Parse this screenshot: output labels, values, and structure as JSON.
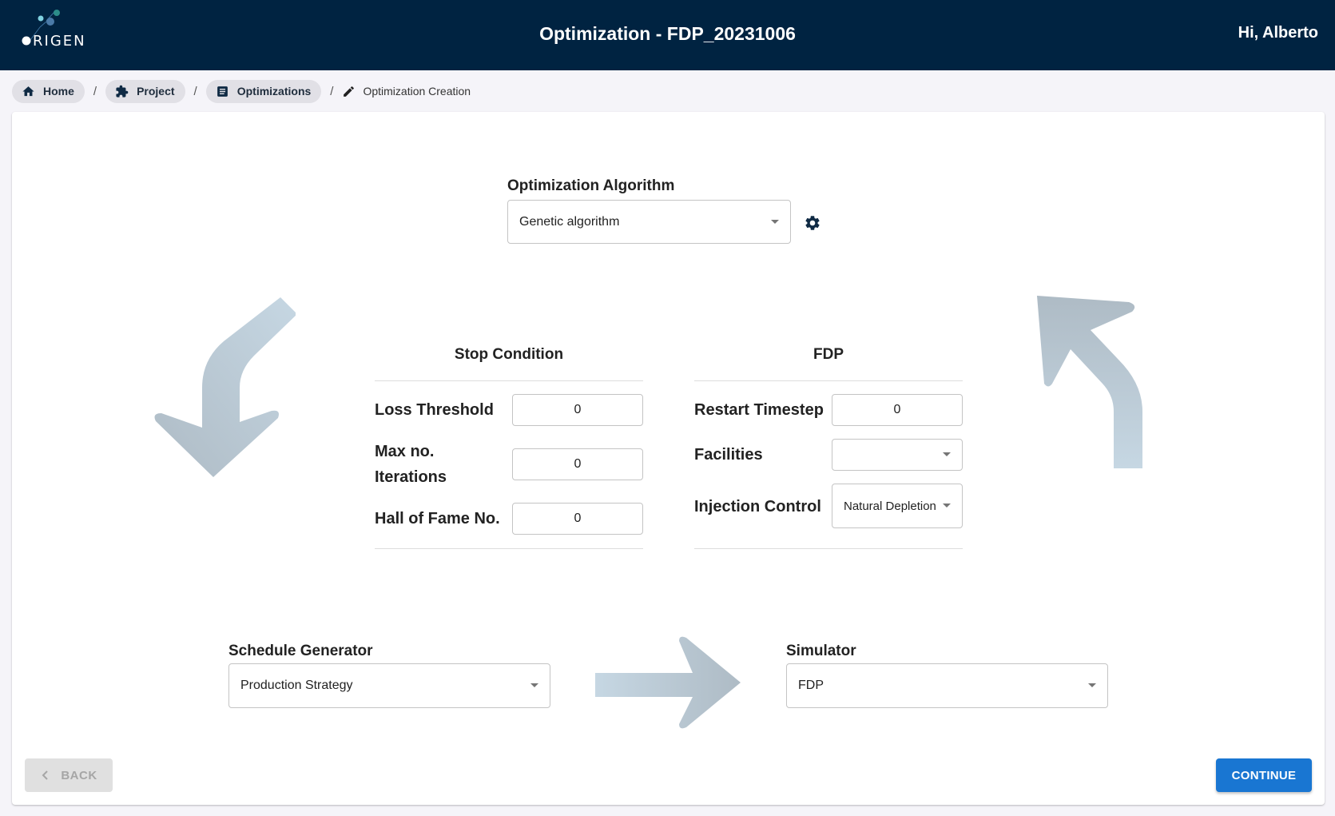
{
  "header": {
    "logo_text": "ORIGEN",
    "title": "Optimization - FDP_20231006",
    "greeting": "Hi, Alberto"
  },
  "breadcrumb": {
    "items": [
      {
        "label": "Home",
        "icon": "home-icon"
      },
      {
        "label": "Project",
        "icon": "puzzle-icon"
      },
      {
        "label": "Optimizations",
        "icon": "document-icon"
      }
    ],
    "separator": "/",
    "current": {
      "label": "Optimization Creation",
      "icon": "pencil-icon"
    }
  },
  "algorithm": {
    "label": "Optimization Algorithm",
    "value": "Genetic algorithm",
    "settings_icon": "gear-icon"
  },
  "stop_condition": {
    "title": "Stop Condition",
    "fields": [
      {
        "label": "Loss Threshold",
        "value": "0"
      },
      {
        "label_line1": "Max no.",
        "label_line2": "Iterations",
        "value": "0"
      },
      {
        "label": "Hall of Fame No.",
        "value": "0"
      }
    ]
  },
  "fdp": {
    "title": "FDP",
    "restart_timestep": {
      "label": "Restart Timestep",
      "value": "0"
    },
    "facilities": {
      "label": "Facilities",
      "value": ""
    },
    "injection_control": {
      "label": "Injection Control",
      "value": "Natural Depletion"
    }
  },
  "schedule_generator": {
    "label": "Schedule Generator",
    "value": "Production Strategy"
  },
  "simulator": {
    "label": "Simulator",
    "value": "FDP"
  },
  "actions": {
    "back_label": "BACK",
    "continue_label": "CONTINUE"
  },
  "colors": {
    "header_bg": "#002341",
    "primary": "#1976d2",
    "arrow": "#b4c3cf"
  }
}
